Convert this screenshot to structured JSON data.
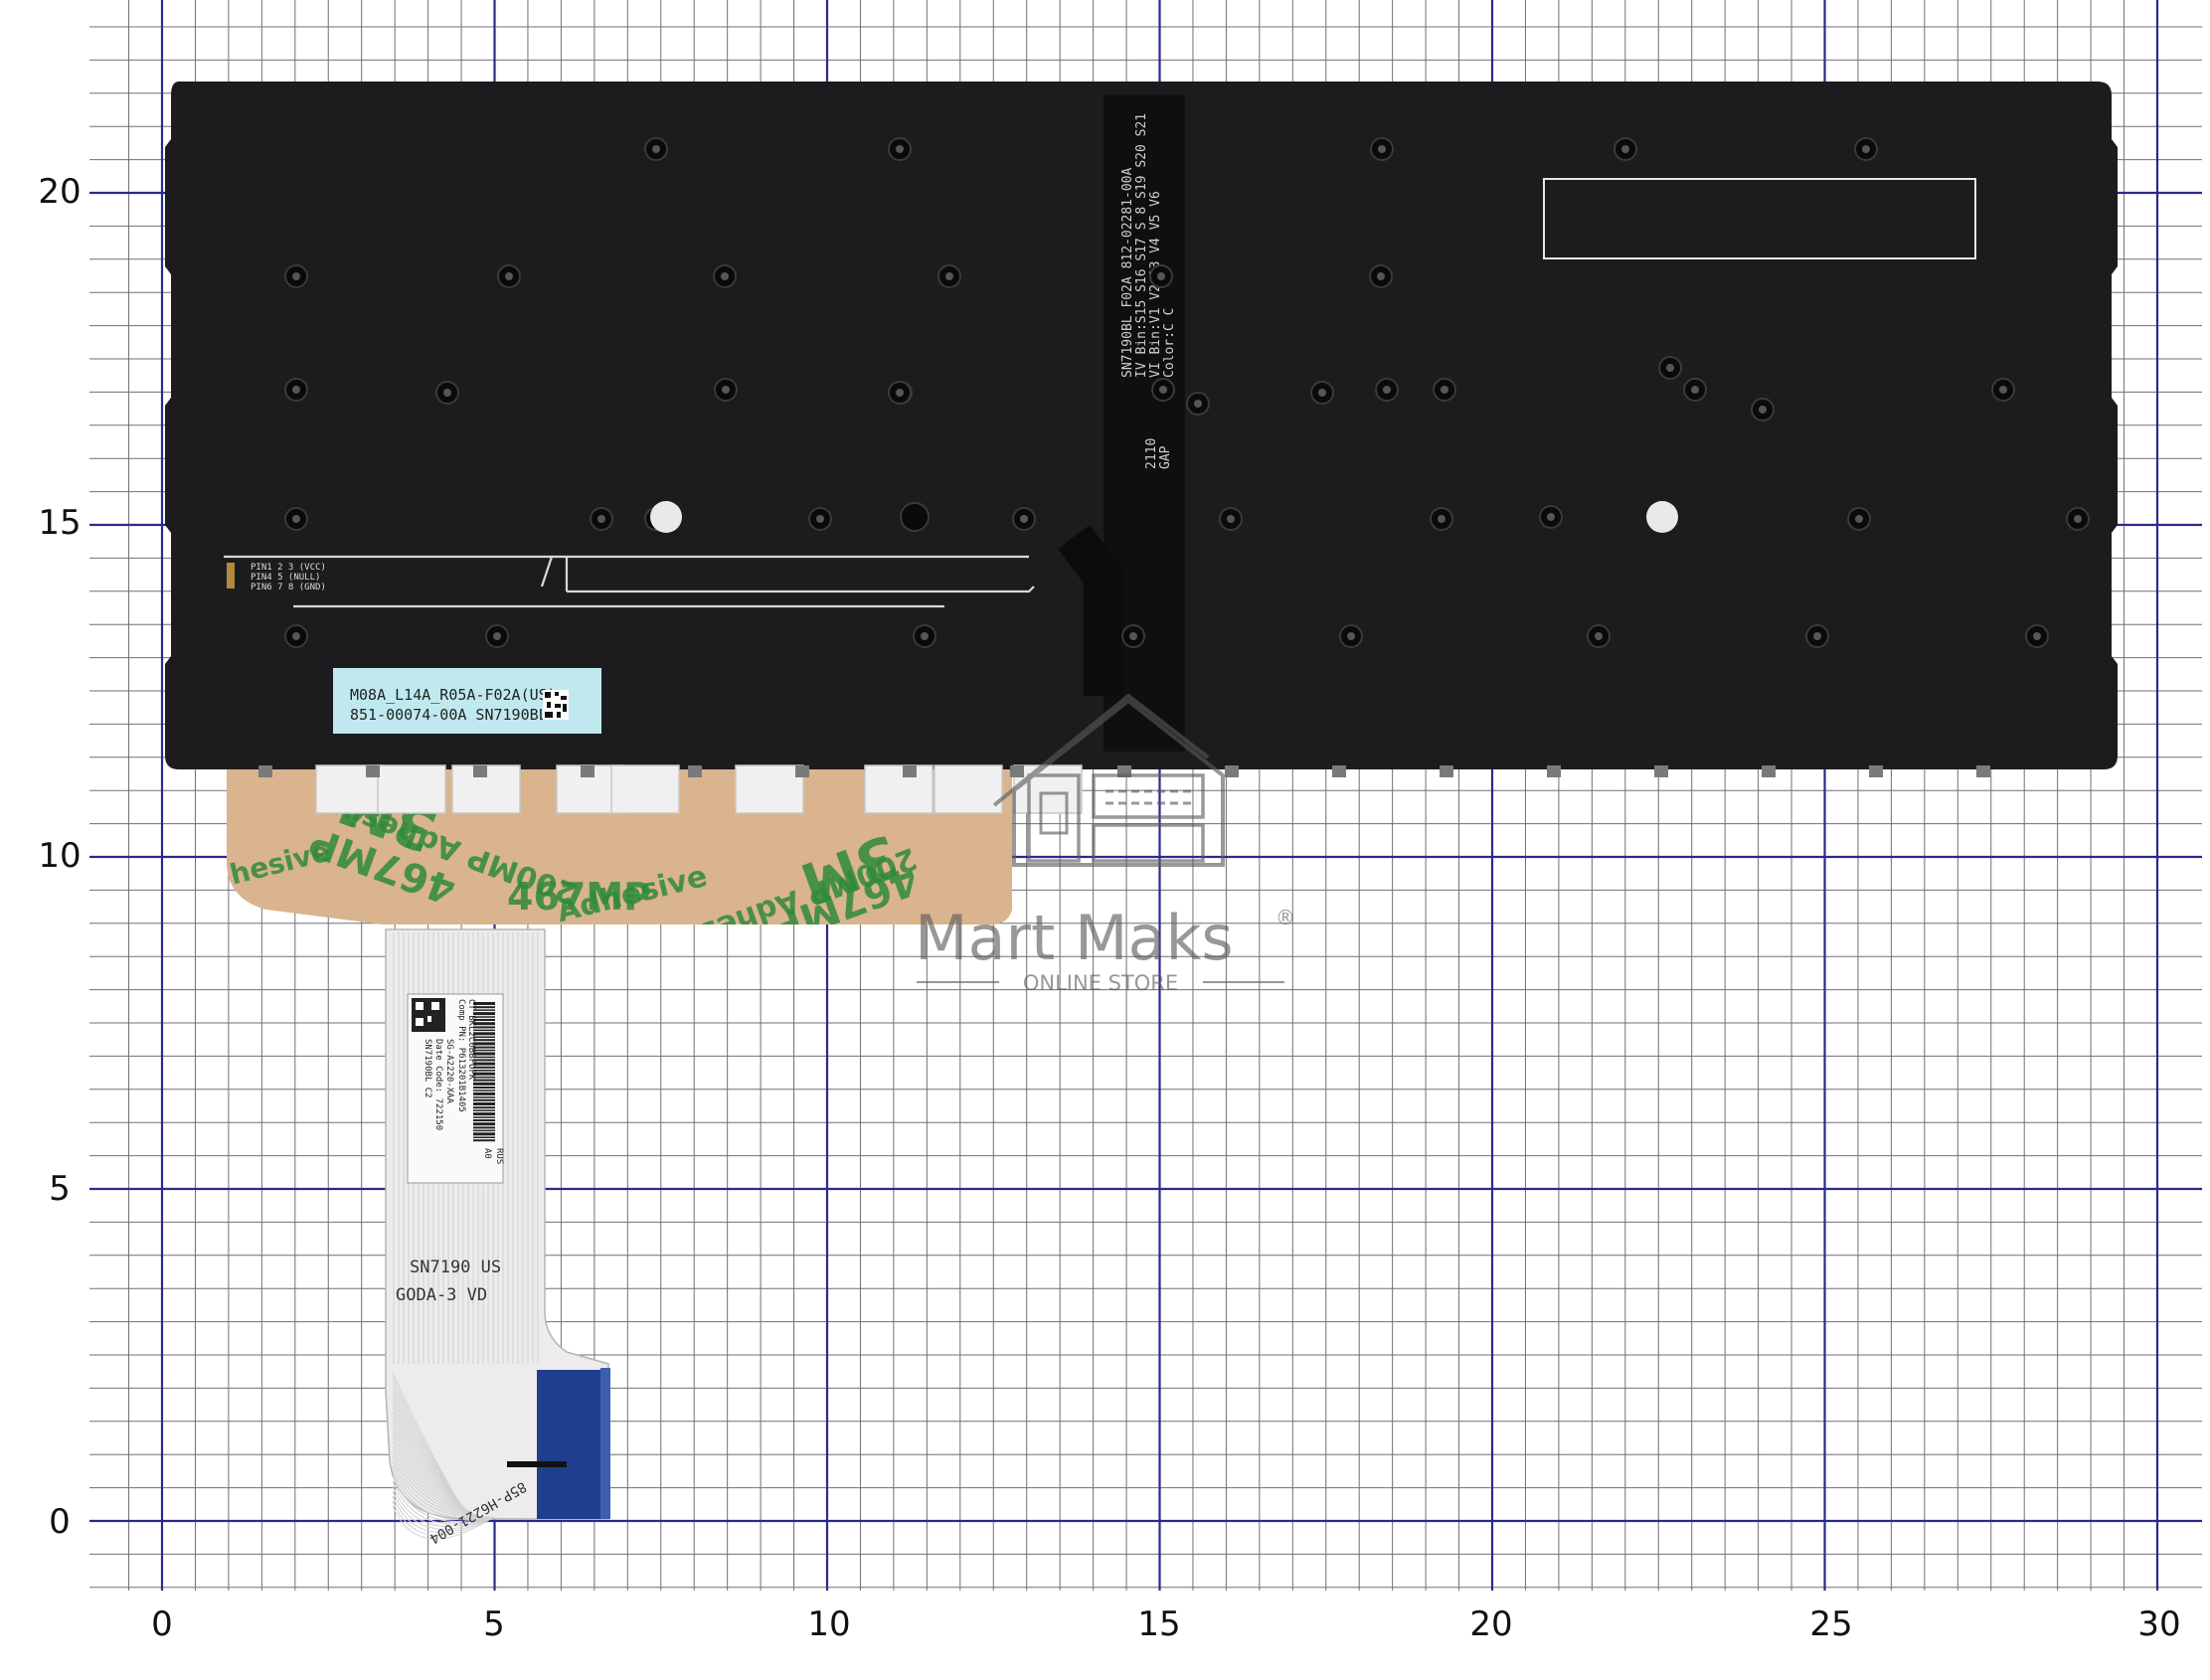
{
  "grid": {
    "x_axis_ticks": [
      "0",
      "5",
      "10",
      "15",
      "20",
      "25",
      "30"
    ],
    "y_axis_ticks": [
      "20",
      "15",
      "10",
      "5",
      "0"
    ],
    "minor_line_color": "#6f6f7a",
    "major_line_color": "#2a2a8c",
    "background_color": "#ffffff"
  },
  "keyboard": {
    "body_color": "#1c1c1e",
    "sticker_color": "#bfe9ee",
    "sticker_text": [
      "M08A_L14A_R05A-F02A(US)",
      "851-00074-00A SN7190BL"
    ],
    "center_strip_text": [
      "SN7190BL F02A 812-02281-00A",
      "IV Bin:S15 S16 S17 S 8 S19 S20 S21",
      "VI Bin:V1 V2 13 V4 V5 V6",
      "Color:C C"
    ],
    "strip_code": [
      "2110",
      "GAP"
    ],
    "pin_legend": [
      "PIN1 2 3 (VCC)",
      "PIN4 5 (NULL)",
      "PIN6 7 8 (GND)"
    ]
  },
  "adhesive": {
    "backing_color": "#d9b48e",
    "print_color": "#2f8a3c",
    "labels": [
      "3M",
      "467MP",
      "200MP Adhesive",
      "3M",
      "467MP",
      "200MP Adhesive",
      "467MP",
      "Adhesive",
      "hesive"
    ]
  },
  "cable": {
    "color": "#efefef",
    "connector_color": "#1f3f8c",
    "label_lines": [
      "CT BKL2C0BBFOFK",
      "Comp PN: P613201B1405",
      "SG-A2220-XAA",
      "Date Code: 722150",
      "SN7190BL C2"
    ],
    "label_side": [
      "RUS",
      "A0"
    ],
    "print_lines": [
      "SN7190 US",
      "GODA-3 VD"
    ],
    "bottom_text": [
      "85P-H6221-004"
    ]
  },
  "watermark": {
    "brand": "Mart Maks",
    "subtitle": "ONLINE STORE",
    "registered": "®"
  }
}
